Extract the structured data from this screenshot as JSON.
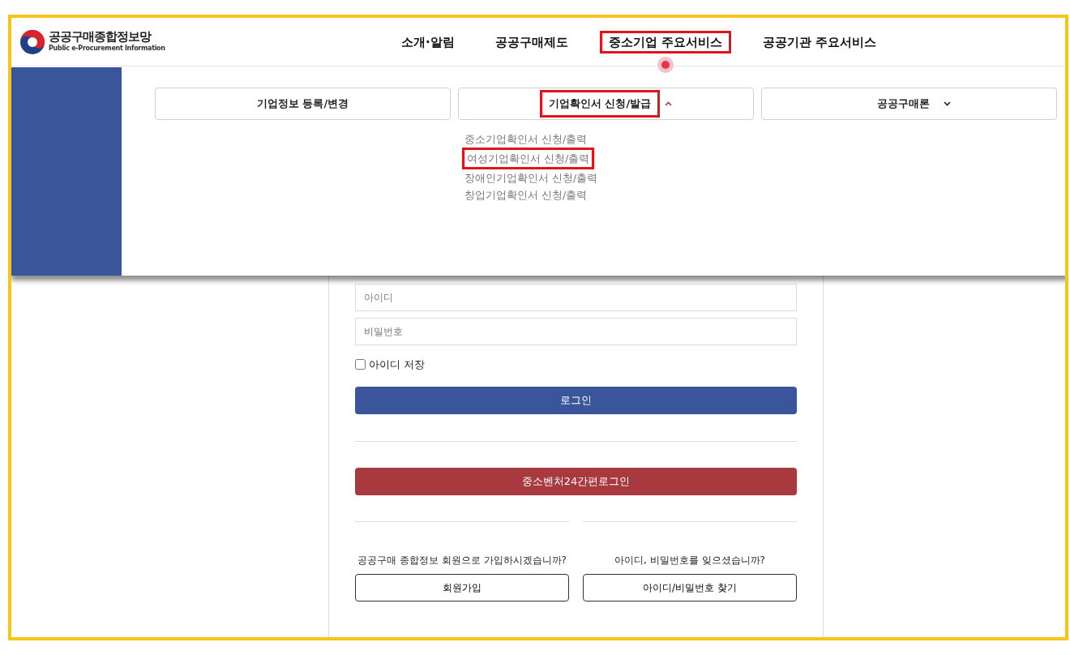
{
  "logo": {
    "title": "공공구매종합정보망",
    "subtitle": "Public e-Procurement Information"
  },
  "nav": [
    {
      "label": "소개·알림",
      "selected": false,
      "highlighted": false
    },
    {
      "label": "공공구매제도",
      "selected": false,
      "highlighted": false
    },
    {
      "label": "중소기업 주요서비스",
      "selected": true,
      "highlighted": true
    },
    {
      "label": "공공기관 주요서비스",
      "selected": false,
      "highlighted": false
    }
  ],
  "submenu_tabs": [
    {
      "label": "기업정보 등록/변경",
      "kind": "plain",
      "highlighted": false
    },
    {
      "label": "기업확인서 신청/발급",
      "kind": "dropdown",
      "expanded": true,
      "highlighted": true
    },
    {
      "label": "공공구매론",
      "kind": "dropdown",
      "expanded": false,
      "highlighted": false
    }
  ],
  "submenu_items": [
    {
      "label": "중소기업확인서 신청/출력",
      "highlighted": false
    },
    {
      "label": "여성기업확인서 신청/출력",
      "highlighted": true
    },
    {
      "label": "장애인기업확인서 신청/출력",
      "highlighted": false
    },
    {
      "label": "창업기업확인서 신청/출력",
      "highlighted": false
    }
  ],
  "login": {
    "id_placeholder": "아이디",
    "password_placeholder": "비밀번호",
    "remember": {
      "label": "아이디 저장",
      "checked": false
    },
    "login_button": "로그인",
    "sso_button": "중소벤처24간편로그인",
    "join": {
      "prompt": "공공구매 종합정보 회원으로 가입하시겠습니까?",
      "button": "회원가입"
    },
    "find": {
      "prompt": "아이디, 비밀번호를 잊으셨습니까?",
      "button": "아이디/비밀번호 찾기"
    }
  }
}
